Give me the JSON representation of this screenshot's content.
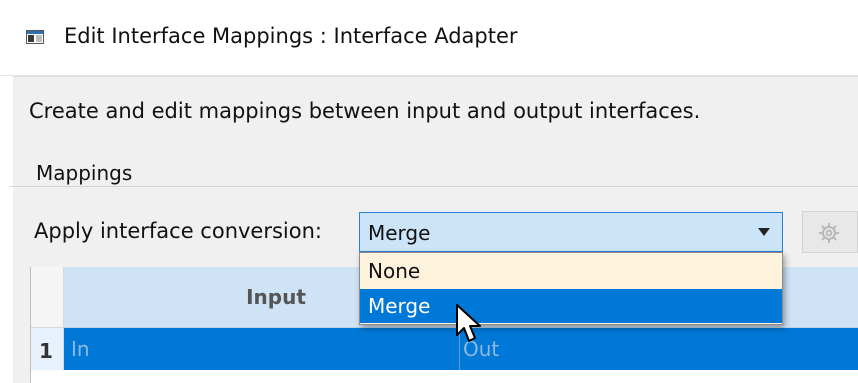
{
  "window": {
    "title": "Edit Interface Mappings : Interface Adapter",
    "icon": "app-window-icon"
  },
  "description": "Create and edit mappings between input and output interfaces.",
  "mappings": {
    "group_title": "Mappings",
    "apply_label": "Apply interface conversion:",
    "conversion_value": "Merge",
    "options": [
      "None",
      "Merge"
    ],
    "highlighted_option": "Merge",
    "settings_button_icon": "gear-icon"
  },
  "table": {
    "columns": [
      "Input",
      ""
    ],
    "rows": [
      {
        "num": "1",
        "input": "In",
        "output": "Out"
      }
    ]
  },
  "colors": {
    "accent": "#0078d7",
    "combo_bg": "#cce4f7",
    "dropdown_bg": "#fdf2dc"
  }
}
